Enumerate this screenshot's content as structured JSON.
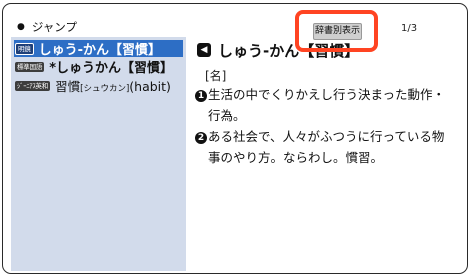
{
  "jump": {
    "label": "ジャンプ"
  },
  "results": [
    {
      "badge": "明鏡",
      "text": "しゅう-かん【習慣】"
    },
    {
      "badge": "標準国語",
      "text": "*しゅうかん【習慣】"
    },
    {
      "badge": "ｼﾞｰﾆｱｽ英和",
      "text_main": "習慣",
      "text_reading": "[シュウカン]",
      "text_en": "(habit)"
    }
  ],
  "toolbar": {
    "dict_button": "辞書別表示",
    "page": "1/3"
  },
  "entry": {
    "headword": "しゅう-かん【習慣】",
    "pos": "[名]",
    "definitions": [
      {
        "num": "1",
        "line1": "生活の中でくりかえし行う決まった動作・",
        "line2": "行為。"
      },
      {
        "num": "2",
        "line1": "ある社会で、人々がふつうに行っている物",
        "line2": "事のやり方。ならわし。慣習。"
      }
    ]
  },
  "colors": {
    "selected_row": "#2d6ec5",
    "left_panel": "#d2dbeb",
    "highlight": "#ff4422"
  }
}
